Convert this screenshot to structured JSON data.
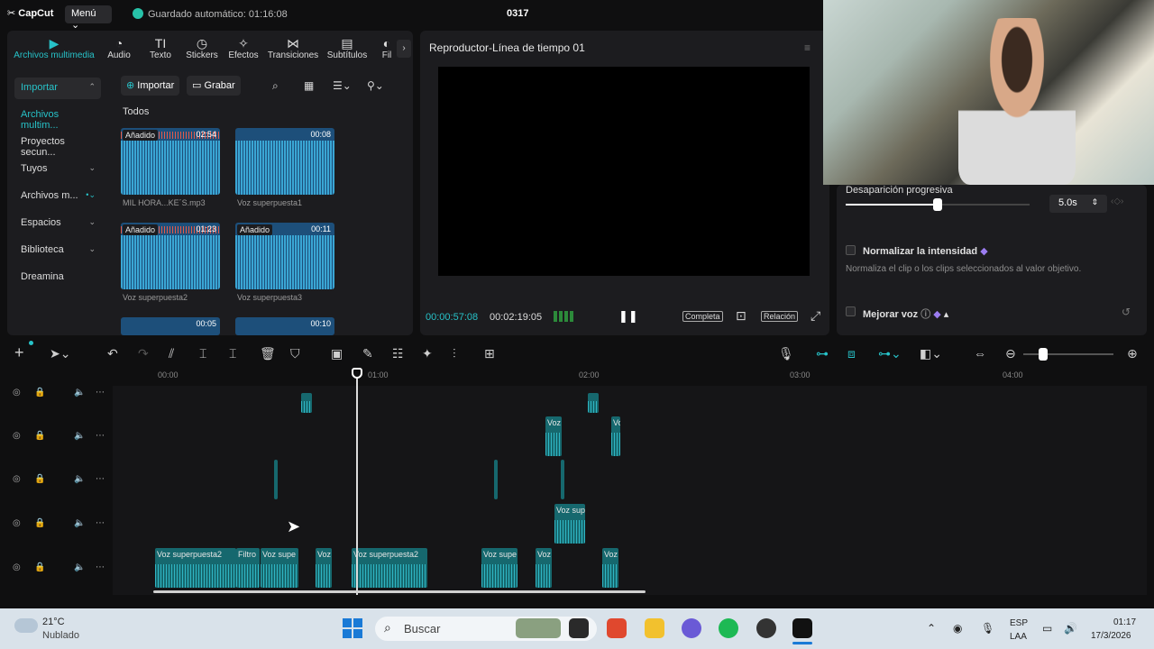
{
  "app": {
    "logo": "CapCut",
    "menu_label": "Menú",
    "autosave": "Guardado automático: 01:16:08",
    "project_title": "0317"
  },
  "media_tabs": [
    {
      "label": "Archivos multimedia",
      "icon": "media-icon"
    },
    {
      "label": "Audio",
      "icon": "audio-icon"
    },
    {
      "label": "Texto",
      "icon": "text-icon"
    },
    {
      "label": "Stickers",
      "icon": "sticker-icon"
    },
    {
      "label": "Efectos",
      "icon": "effects-icon"
    },
    {
      "label": "Transiciones",
      "icon": "transition-icon"
    },
    {
      "label": "Subtítulos",
      "icon": "subtitles-icon"
    },
    {
      "label": "Fil",
      "icon": "filter-icon"
    }
  ],
  "sidebar": {
    "items": [
      {
        "label": "Importar"
      },
      {
        "label": "Archivos multim..."
      },
      {
        "label": "Proyectos secun..."
      },
      {
        "label": "Tuyos"
      },
      {
        "label": "Archivos m..."
      },
      {
        "label": "Espacios"
      },
      {
        "label": "Biblioteca"
      },
      {
        "label": "Dreamina"
      }
    ]
  },
  "media": {
    "import_label": "Importar",
    "record_label": "Grabar",
    "section_label": "Todos",
    "items": [
      {
        "badge": "Añadido",
        "duration": "02:54",
        "name": "MIL HORA...KE´S.mp3"
      },
      {
        "badge": "",
        "duration": "00:08",
        "name": "Voz superpuesta1"
      },
      {
        "badge": "Añadido",
        "duration": "01:23",
        "name": "Voz superpuesta2"
      },
      {
        "badge": "Añadido",
        "duration": "00:11",
        "name": "Voz superpuesta3"
      },
      {
        "badge": "",
        "duration": "00:05",
        "name": ""
      },
      {
        "badge": "",
        "duration": "00:10",
        "name": ""
      }
    ]
  },
  "player": {
    "title": "Reproductor-Línea de tiempo 01",
    "current_time": "00:00:57:08",
    "total_time": "00:02:19:05",
    "full_label": "Completa",
    "ratio_label": "Relación"
  },
  "inspector": {
    "fade_label": "Desaparición progresiva",
    "fade_value": "5.0s",
    "fade_level_fraction": 0.5,
    "normalize_label": "Normalizar la intensidad",
    "normalize_desc": "Normaliza el clip o los clips seleccionados al valor objetivo.",
    "enhance_label": "Mejorar voz"
  },
  "timeline": {
    "ruler_labels": [
      "00:00",
      "01:00",
      "02:00",
      "03:00",
      "04:00"
    ],
    "clips": [
      {
        "label": "Voz superpuesta2"
      },
      {
        "label": "Filtro"
      },
      {
        "label": "Voz supe"
      },
      {
        "label": "Voz"
      },
      {
        "label": "Voz superpuesta2"
      },
      {
        "label": "Voz supe"
      },
      {
        "label": "Voz"
      },
      {
        "label": "Voz"
      },
      {
        "label": "Voz sup"
      },
      {
        "label": "Voz"
      },
      {
        "label": "Vo"
      }
    ]
  },
  "taskbar": {
    "weather_temp": "21°C",
    "weather_desc": "Nublado",
    "search_placeholder": "Buscar",
    "lang_top": "ESP",
    "lang_bottom": "LAA",
    "time": "01:17",
    "date": "17/3/2026"
  },
  "colors": {
    "accent": "#27c2c8",
    "clip": "#16686e",
    "background": "#0f0f10",
    "panel": "#1c1c1f"
  }
}
